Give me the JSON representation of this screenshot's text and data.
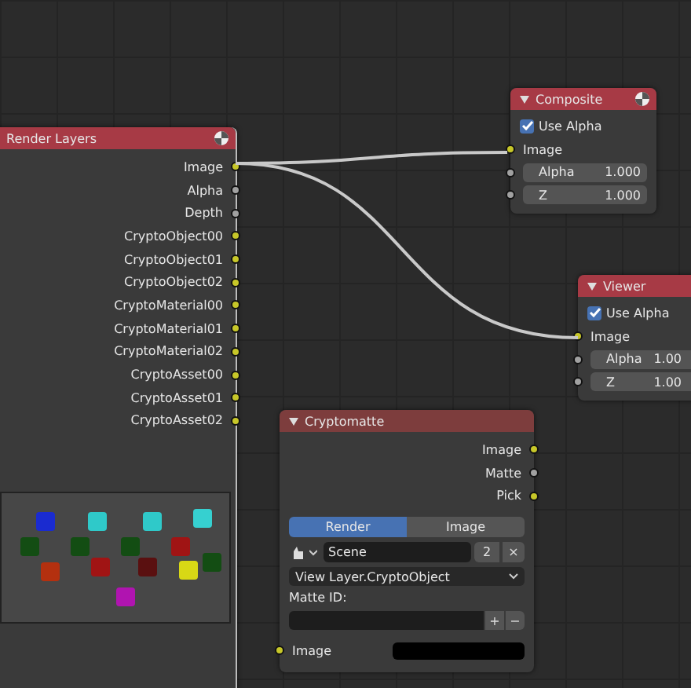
{
  "render_layers": {
    "title": "Render Layers",
    "outputs": [
      {
        "label": "Image",
        "kind": "color"
      },
      {
        "label": "Alpha",
        "kind": "value"
      },
      {
        "label": "Depth",
        "kind": "value"
      },
      {
        "label": "CryptoObject00",
        "kind": "color"
      },
      {
        "label": "CryptoObject01",
        "kind": "color"
      },
      {
        "label": "CryptoObject02",
        "kind": "color"
      },
      {
        "label": "CryptoMaterial00",
        "kind": "color"
      },
      {
        "label": "CryptoMaterial01",
        "kind": "color"
      },
      {
        "label": "CryptoMaterial02",
        "kind": "color"
      },
      {
        "label": "CryptoAsset00",
        "kind": "color"
      },
      {
        "label": "CryptoAsset01",
        "kind": "color"
      },
      {
        "label": "CryptoAsset02",
        "kind": "color"
      }
    ]
  },
  "output_nodes": [
    {
      "title": "Composite",
      "use_alpha": {
        "label": "Use Alpha",
        "checked": true
      },
      "inputs": [
        {
          "label": "Image",
          "kind": "color"
        },
        {
          "label": "Alpha",
          "kind": "value",
          "value": "1.000"
        },
        {
          "label": "Z",
          "kind": "value",
          "value": "1.000"
        }
      ]
    },
    {
      "title": "Viewer",
      "use_alpha": {
        "label": "Use Alpha",
        "checked": true
      },
      "inputs": [
        {
          "label": "Image",
          "kind": "color"
        },
        {
          "label": "Alpha",
          "kind": "value",
          "value": "1.00"
        },
        {
          "label": "Z",
          "kind": "value",
          "value": "1.00"
        }
      ]
    }
  ],
  "cryptomatte": {
    "title": "Cryptomatte",
    "outputs": [
      {
        "label": "Image",
        "kind": "color"
      },
      {
        "label": "Matte",
        "kind": "value"
      },
      {
        "label": "Pick",
        "kind": "color"
      }
    ],
    "source_tabs": [
      {
        "label": "Render",
        "selected": true
      },
      {
        "label": "Image",
        "selected": false
      }
    ],
    "scene": {
      "value": "Scene",
      "users": "2",
      "clear": "×"
    },
    "layer": {
      "value": "View Layer.CryptoObject"
    },
    "matte_id": {
      "label": "Matte ID:",
      "add": "+",
      "remove": "−"
    },
    "inputs": [
      {
        "label": "Image",
        "kind": "color"
      }
    ]
  }
}
